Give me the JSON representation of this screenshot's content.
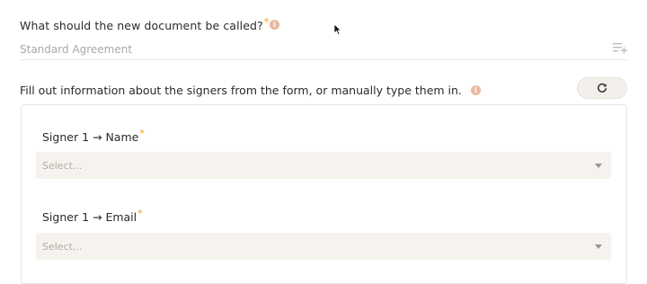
{
  "document_name": {
    "question": "What should the new document be called?",
    "required_mark": "*",
    "placeholder": "Standard Agreement"
  },
  "signers": {
    "instructions": "Fill out information about the signers from the form, or manually type them in.",
    "fields": [
      {
        "label": "Signer 1 → Name",
        "required_mark": "*",
        "placeholder": "Select..."
      },
      {
        "label": "Signer 1 → Email",
        "required_mark": "*",
        "placeholder": "Select..."
      }
    ]
  },
  "colors": {
    "required": "#f0a020",
    "info_icon": "#e8b8a0",
    "select_bg": "#f6f3ee",
    "refresh_bg": "#f3efea"
  },
  "icons": [
    "info-icon",
    "list-add-icon",
    "refresh-icon",
    "chevron-down-icon",
    "mouse-cursor-icon"
  ]
}
